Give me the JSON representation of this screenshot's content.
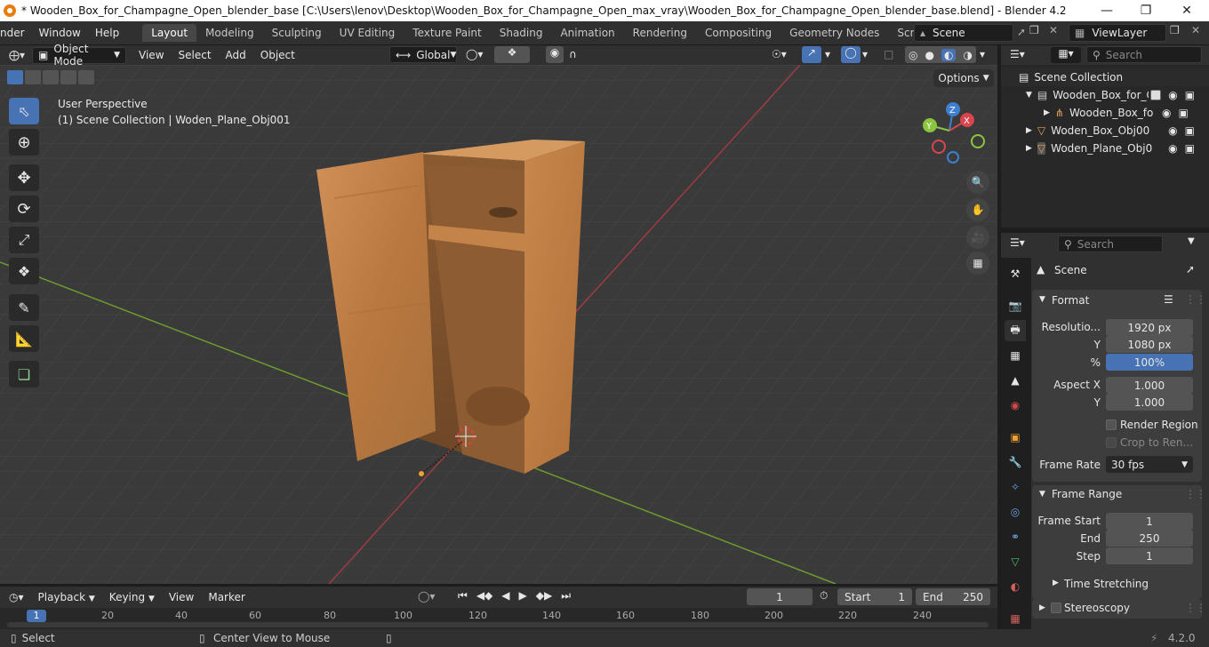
{
  "title_bar": {
    "title": "* Wooden_Box_for_Champagne_Open_blender_base [C:\\Users\\lenov\\Desktop\\Wooden_Box_for_Champagne_Open_max_vray\\Wooden_Box_for_Champagne_Open_blender_base.blend] - Blender 4.2"
  },
  "menu": {
    "items": [
      "nder",
      "Window",
      "Help"
    ]
  },
  "workspace_tabs": [
    "Layout",
    "Modeling",
    "Sculpting",
    "UV Editing",
    "Texture Paint",
    "Shading",
    "Animation",
    "Rendering",
    "Compositing",
    "Geometry Nodes",
    "Scripting"
  ],
  "active_workspace": "Layout",
  "scene_name": "Scene",
  "view_layer": "ViewLayer",
  "viewport_header": {
    "mode": "Object Mode",
    "menus": [
      "View",
      "Select",
      "Add",
      "Object"
    ],
    "orientation": "Global",
    "options_label": "Options"
  },
  "viewport": {
    "perspective": "User Perspective",
    "collection_info": "(1) Scene Collection | Woden_Plane_Obj001",
    "gizmo": {
      "x": "X",
      "y": "Y",
      "z": "Z"
    }
  },
  "outliner": {
    "search_placeholder": "Search",
    "root": "Scene Collection",
    "rows": [
      {
        "label": "Wooden_Box_for_C"
      },
      {
        "label": "Wooden_Box_fo"
      },
      {
        "label": "Woden_Box_Obj00"
      },
      {
        "label": "Woden_Plane_Obj0"
      }
    ]
  },
  "properties": {
    "search_placeholder": "Search",
    "context": "Scene",
    "format": {
      "header": "Format",
      "resolution_label": "Resolutio...",
      "res_x": "1920 px",
      "y_label": "Y",
      "res_y": "1080 px",
      "pct_label": "%",
      "pct": "100%",
      "aspect_label": "Aspect X",
      "aspect_x": "1.000",
      "aspect_y": "1.000",
      "render_region": "Render Region",
      "crop": "Crop to Ren...",
      "frame_rate_label": "Frame Rate",
      "frame_rate": "30 fps"
    },
    "frame_range": {
      "header": "Frame Range",
      "start_label": "Frame Start",
      "start": "1",
      "end_label": "End",
      "end": "250",
      "step_label": "Step",
      "step": "1"
    },
    "time_stretching": "Time Stretching",
    "stereoscopy": "Stereoscopy"
  },
  "timeline": {
    "menus": [
      "Playback",
      "Keying",
      "View",
      "Marker"
    ],
    "current_frame": "1",
    "start_label": "Start",
    "start": "1",
    "end_label": "End",
    "end": "250",
    "ticks": [
      "1",
      "20",
      "40",
      "60",
      "80",
      "100",
      "120",
      "140",
      "160",
      "180",
      "200",
      "220",
      "240"
    ]
  },
  "status_bar": {
    "select": "Select",
    "center_view": "Center View to Mouse",
    "version": "4.2.0"
  },
  "colors": {
    "accent": "#4772b3",
    "x_axis": "#d9454f",
    "y_axis": "#8bc53f",
    "z_axis": "#3f7fd1",
    "wood": "#c88a4e"
  }
}
